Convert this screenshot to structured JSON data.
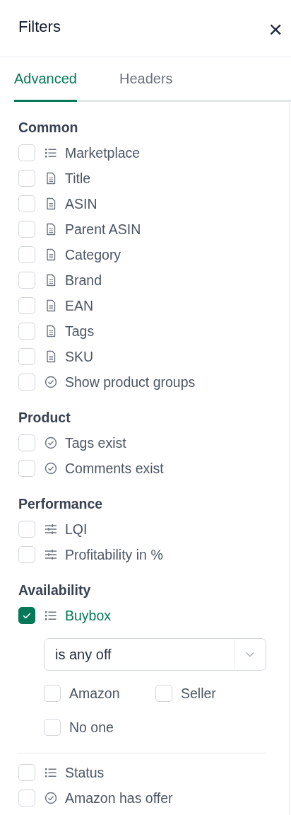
{
  "header": {
    "title": "Filters",
    "close": "×"
  },
  "tabs": [
    {
      "label": "Advanced",
      "selected": true
    },
    {
      "label": "Headers",
      "selected": false
    }
  ],
  "sections": [
    {
      "title": "Common",
      "items": [
        {
          "label": "Marketplace",
          "kind": "list",
          "checked": false
        },
        {
          "label": "Title",
          "kind": "text",
          "checked": false
        },
        {
          "label": "ASIN",
          "kind": "text",
          "checked": false
        },
        {
          "label": "Parent ASIN",
          "kind": "text",
          "checked": false
        },
        {
          "label": "Category",
          "kind": "text",
          "checked": false
        },
        {
          "label": "Brand",
          "kind": "text",
          "checked": false
        },
        {
          "label": "EAN",
          "kind": "text",
          "checked": false
        },
        {
          "label": "Tags",
          "kind": "text",
          "checked": false
        },
        {
          "label": "SKU",
          "kind": "text",
          "checked": false
        },
        {
          "label": "Show product groups",
          "kind": "bool",
          "checked": false
        }
      ]
    },
    {
      "title": "Product",
      "items": [
        {
          "label": "Tags exist",
          "kind": "bool",
          "checked": false
        },
        {
          "label": "Comments exist",
          "kind": "bool",
          "checked": false
        }
      ]
    },
    {
      "title": "Performance",
      "items": [
        {
          "label": "LQI",
          "kind": "range",
          "checked": false
        },
        {
          "label": "Profitability in %",
          "kind": "range",
          "checked": false
        }
      ]
    },
    {
      "title": "Availability",
      "items": [
        {
          "label": "Buybox",
          "kind": "list",
          "checked": true,
          "expanded": true,
          "select": {
            "value": "is any off"
          },
          "options": [
            {
              "label": "Amazon",
              "checked": false
            },
            {
              "label": "Seller",
              "checked": false
            },
            {
              "label": "No one",
              "checked": false
            }
          ]
        },
        {
          "label": "Status",
          "kind": "list",
          "checked": false
        },
        {
          "label": "Amazon has offer",
          "kind": "bool",
          "checked": false
        }
      ]
    }
  ]
}
